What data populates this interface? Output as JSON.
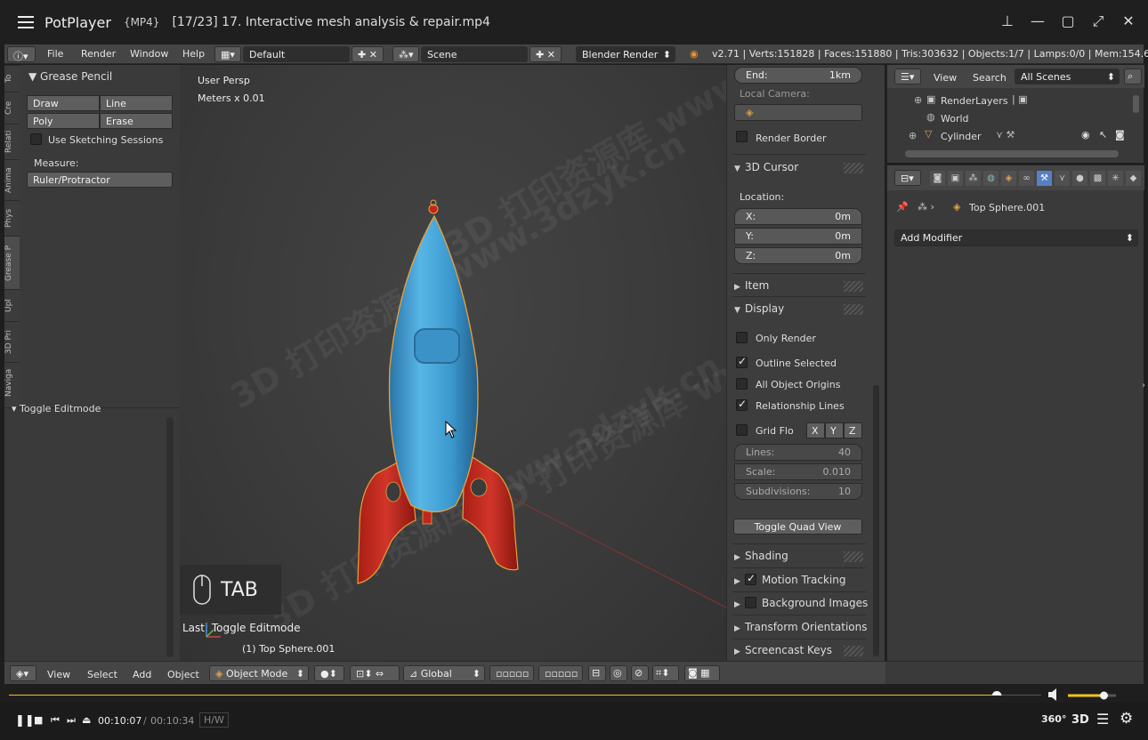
{
  "player": {
    "app_name": "PotPlayer",
    "format": "{MP4}",
    "title": "[17/23] 17. Interactive mesh analysis & repair.mp4",
    "time_current": "00:10:07",
    "time_separator": "/",
    "time_total": "00:10:34",
    "hw_label": "H/W",
    "progress_fraction": 0.957,
    "volume_fraction": 0.75,
    "mode_360": "360°",
    "mode_3d": "3D"
  },
  "blender_header": {
    "menus": [
      "File",
      "Render",
      "Window",
      "Help"
    ],
    "layout": "Default",
    "scene": "Scene",
    "engine": "Blender Render",
    "stats": "v2.71 | Verts:151828 | Faces:151880 | Tris:303632 | Objects:1/7 | Lamps:0/0 | Mem:154.62M"
  },
  "tool_tabs": [
    "To",
    "Cre",
    "Relati",
    "Anima",
    "Phys",
    "Grease P",
    "Upl",
    "3D Pri",
    "Naviga"
  ],
  "tool_shelf": {
    "panel_title": "Grease Pencil",
    "draw": "Draw",
    "line": "Line",
    "poly": "Poly",
    "erase": "Erase",
    "sketching": "Use Sketching Sessions",
    "measure_label": "Measure:",
    "ruler": "Ruler/Protractor",
    "operator": "Toggle Editmode"
  },
  "viewport": {
    "view_name": "User Persp",
    "units": "Meters x 0.01",
    "key_display": "TAB",
    "last_op": "Last: Toggle Editmode",
    "object_label": "(1) Top Sphere.001",
    "watermark": "3D 打印资源库 www.3dzyk.cn"
  },
  "npanel": {
    "end_label": "End:",
    "end_value": "1km",
    "local_camera": "Local Camera:",
    "render_border": "Render Border",
    "cursor_title": "3D Cursor",
    "location": "Location:",
    "x_label": "X:",
    "x_value": "0m",
    "y_label": "Y:",
    "y_value": "0m",
    "z_label": "Z:",
    "z_value": "0m",
    "item": "Item",
    "display": "Display",
    "only_render": "Only Render",
    "outline_selected": "Outline Selected",
    "all_origins": "All Object Origins",
    "relationship_lines": "Relationship Lines",
    "grid_floor": "Grid Flo",
    "axis_x": "X",
    "axis_y": "Y",
    "axis_z": "Z",
    "lines_label": "Lines:",
    "lines_value": "40",
    "scale_label": "Scale:",
    "scale_value": "0.010",
    "subdiv_label": "Subdivisions:",
    "subdiv_value": "10",
    "toggle_quad": "Toggle Quad View",
    "shading": "Shading",
    "motion_tracking": "Motion Tracking",
    "background_images": "Background Images",
    "transform_orientations": "Transform Orientations",
    "screencast_keys": "Screencast Keys"
  },
  "outliner": {
    "view": "View",
    "search": "Search",
    "filter": "All Scenes",
    "items": [
      "RenderLayers",
      "World",
      "Cylinder"
    ]
  },
  "properties": {
    "object_name": "Top Sphere.001",
    "add_modifier": "Add Modifier"
  },
  "footer": {
    "menus": [
      "View",
      "Select",
      "Add",
      "Object"
    ],
    "mode": "Object Mode",
    "orientation": "Global"
  },
  "colors": {
    "rocket_body": "#3f9fd2",
    "rocket_fins": "#c0281c",
    "outline": "#e8a23a",
    "accent_yellow": "#f0c419"
  }
}
